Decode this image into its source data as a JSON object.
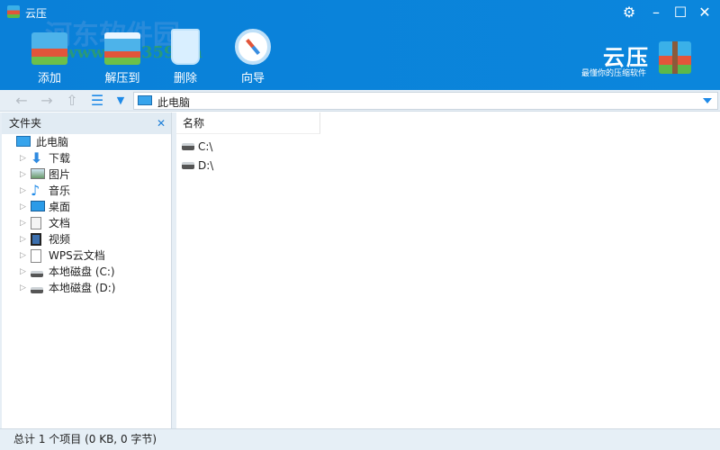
{
  "window": {
    "title": "云压"
  },
  "watermark": {
    "line1": "河东软件园",
    "line2": "www.pc0359.cn"
  },
  "toolbar": {
    "add": "添加",
    "extract": "解压到",
    "delete": "删除",
    "wizard": "向导"
  },
  "brand": {
    "name": "云压",
    "slogan": "最懂你的压缩软件"
  },
  "nav": {
    "path": "此电脑"
  },
  "folders": {
    "header": "文件夹",
    "root": "此电脑",
    "items": [
      "下载",
      "图片",
      "音乐",
      "桌面",
      "文档",
      "视频",
      "WPS云文档",
      "本地磁盘 (C:)",
      "本地磁盘 (D:)"
    ]
  },
  "list": {
    "column_name": "名称",
    "items": [
      "C:\\",
      "D:\\"
    ]
  },
  "status": {
    "text": "总计 1 个项目 (0 KB, 0 字节)"
  }
}
